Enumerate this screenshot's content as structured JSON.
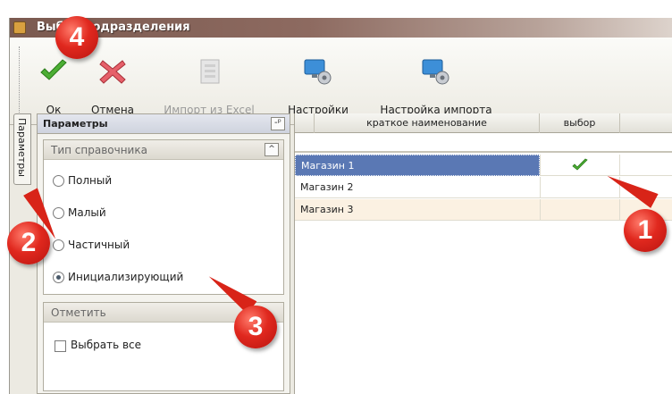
{
  "window": {
    "title": "Выбор подразделения"
  },
  "toolbar": {
    "buttons": [
      {
        "label": "Ок",
        "icon": "check-icon",
        "enabled": true
      },
      {
        "label": "Отмена",
        "icon": "cancel-x-icon",
        "enabled": true
      },
      {
        "label": "Импорт из Excel",
        "icon": "excel-import-icon",
        "enabled": false
      },
      {
        "label": "Настройки",
        "icon": "settings-monitor-icon",
        "enabled": true
      },
      {
        "label": "Настройка импорта",
        "icon": "import-settings-monitor-icon",
        "enabled": true
      }
    ]
  },
  "side_tab": {
    "label": "Параметры"
  },
  "params_pane": {
    "header": "Параметры",
    "pin_label": "-ᵖ",
    "directory_type": {
      "header": "Тип справочника",
      "collapse_label": "^",
      "options": [
        {
          "label": "Полный",
          "checked": false
        },
        {
          "label": "Малый",
          "checked": false
        },
        {
          "label": "Частичный",
          "checked": false
        },
        {
          "label": "Инициализирующий",
          "checked": true
        }
      ]
    },
    "mark": {
      "header": "Отметить",
      "select_all_label": "Выбрать все",
      "select_all_checked": false
    }
  },
  "grid": {
    "columns": [
      "краткое наименование",
      "выбор"
    ],
    "rows": [
      {
        "name": "Магазин 1",
        "selected": true,
        "picked": true
      },
      {
        "name": "Магазин 2",
        "selected": false,
        "picked": false
      },
      {
        "name": "Магазин 3",
        "selected": false,
        "picked": false
      }
    ]
  },
  "annotations": [
    "1",
    "2",
    "3",
    "4"
  ],
  "colors": {
    "annotation_red": "#d82418",
    "selection_blue": "#5a78b4",
    "row_alt": "#fbf1e2",
    "title_brown": "#7b5a50"
  }
}
